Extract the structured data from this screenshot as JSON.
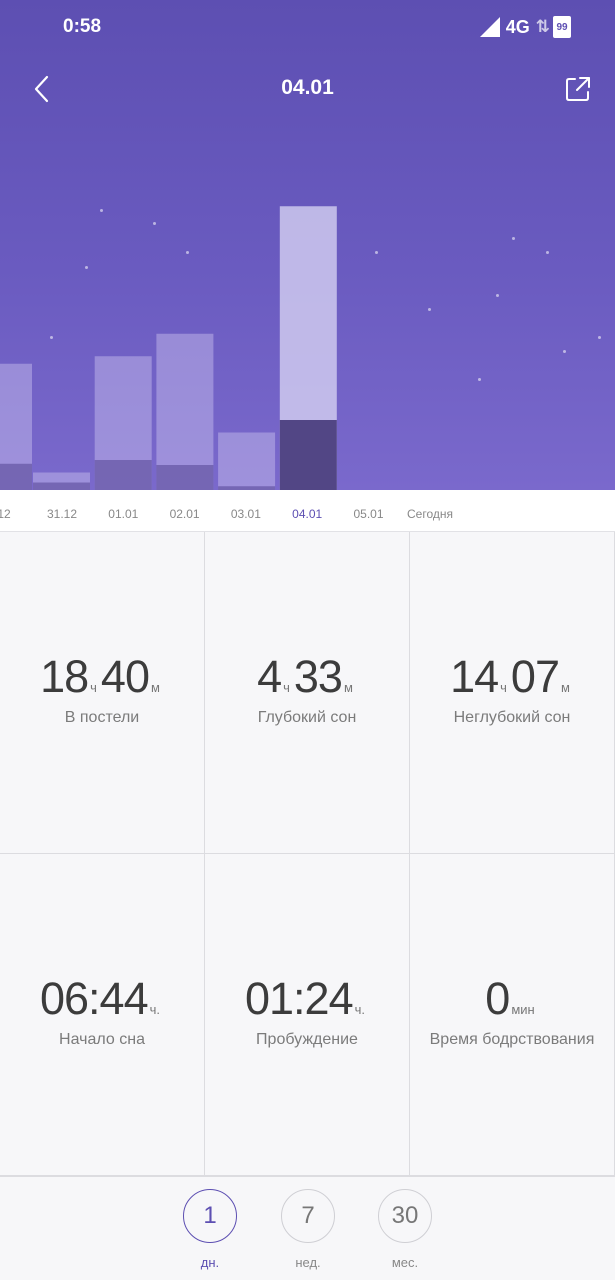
{
  "status_bar": {
    "time": "0:58",
    "network": "4G",
    "battery": "99"
  },
  "nav": {
    "title": "04.01"
  },
  "colors": {
    "accent": "#5d4fb2",
    "header_top": "#5d4fb2",
    "header_bottom": "#7a69cc"
  },
  "chart_data": {
    "type": "bar",
    "categories": [
      "12",
      "31.12",
      "01.01",
      "02.01",
      "03.01",
      "04.01",
      "05.01",
      "Сегодня"
    ],
    "selected": "04.01",
    "series": [
      {
        "name": "",
        "values": [
          10.1,
          1.4,
          10.7,
          12.5,
          4.6,
          22.7,
          0,
          0
        ]
      },
      {
        "name": "",
        "values": [
          2.1,
          0.6,
          2.4,
          2.0,
          0.3,
          5.6,
          0,
          0
        ]
      }
    ],
    "ylim": [
      0,
      32
    ]
  },
  "stats": [
    {
      "parts": [
        [
          "18",
          "ч"
        ],
        [
          "40",
          "м"
        ]
      ],
      "label": "В постели"
    },
    {
      "parts": [
        [
          "4",
          "ч"
        ],
        [
          "33",
          "м"
        ]
      ],
      "label": "Глубокий сон"
    },
    {
      "parts": [
        [
          "14",
          "ч"
        ],
        [
          "07",
          "м"
        ]
      ],
      "label": "Неглубокий сон"
    },
    {
      "parts": [
        [
          "06:44",
          "ч."
        ]
      ],
      "label": "Начало сна"
    },
    {
      "parts": [
        [
          "01:24",
          "ч."
        ]
      ],
      "label": "Пробуждение"
    },
    {
      "parts": [
        [
          "0",
          "мин"
        ]
      ],
      "label": "Время бодрствования"
    }
  ],
  "ranges": [
    {
      "value": "1",
      "label": "дн.",
      "selected": true
    },
    {
      "value": "7",
      "label": "нед.",
      "selected": false
    },
    {
      "value": "30",
      "label": "мес.",
      "selected": false
    }
  ]
}
